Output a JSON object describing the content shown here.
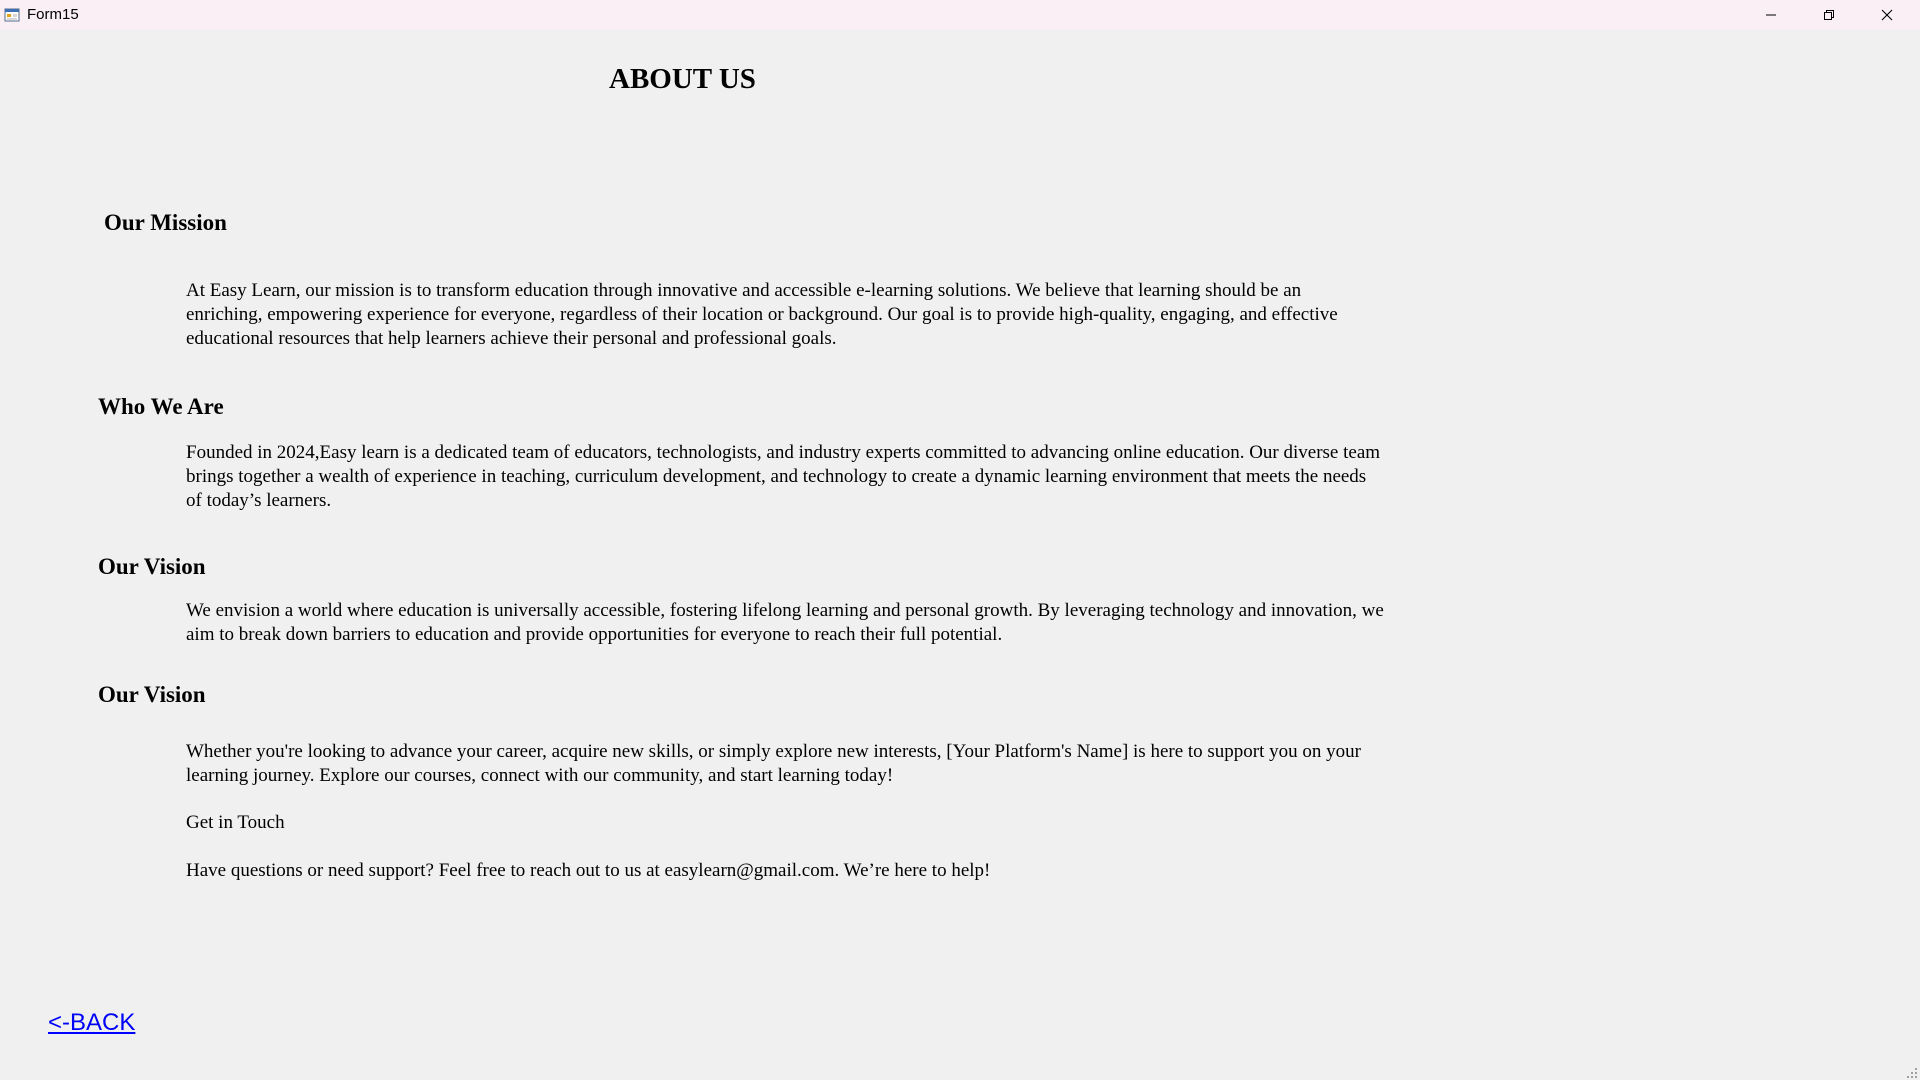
{
  "window": {
    "title": "Form15",
    "icon": "app-form-icon",
    "controls": {
      "minimize_icon": "minimize-icon",
      "maximize_icon": "restore-icon",
      "close_icon": "close-icon"
    }
  },
  "page": {
    "title": "ABOUT US"
  },
  "sections": [
    {
      "heading": "Our Mission",
      "paragraphs": [
        "At Easy Learn, our mission is to transform education through innovative and accessible e-learning solutions. We believe that learning should be an enriching, empowering experience for everyone, regardless of their location or background. Our goal is to provide high-quality, engaging, and effective educational resources that help learners achieve their personal and professional goals."
      ]
    },
    {
      "heading": "Who We Are",
      "paragraphs": [
        "Founded in 2024,Easy learn is a dedicated team of educators, technologists, and industry experts committed to advancing online education. Our diverse team brings together a wealth of experience in teaching, curriculum development, and technology to create a dynamic learning environment that meets the needs of today’s learners."
      ]
    },
    {
      "heading": "Our Vision",
      "paragraphs": [
        "We envision a world where education is universally accessible, fostering lifelong learning and personal growth. By leveraging technology and innovation, we aim to break down barriers to education and provide opportunities for everyone to reach their full potential."
      ]
    },
    {
      "heading": "Our Vision",
      "paragraphs": [
        "Whether you're looking to advance your career, acquire new skills, or simply explore new interests, [Your Platform's Name] is here to support you on your learning journey. Explore our courses, connect with our community, and start learning today!",
        "Get in Touch",
        "Have questions or need support? Feel free to reach out to us at easylearn@gmail.com. We’re here to help!"
      ]
    }
  ],
  "back_link": {
    "label": "<-BACK"
  },
  "colors": {
    "background": "#f0f0f0",
    "titlebar": "#f9eff4",
    "link": "#0000ff"
  }
}
